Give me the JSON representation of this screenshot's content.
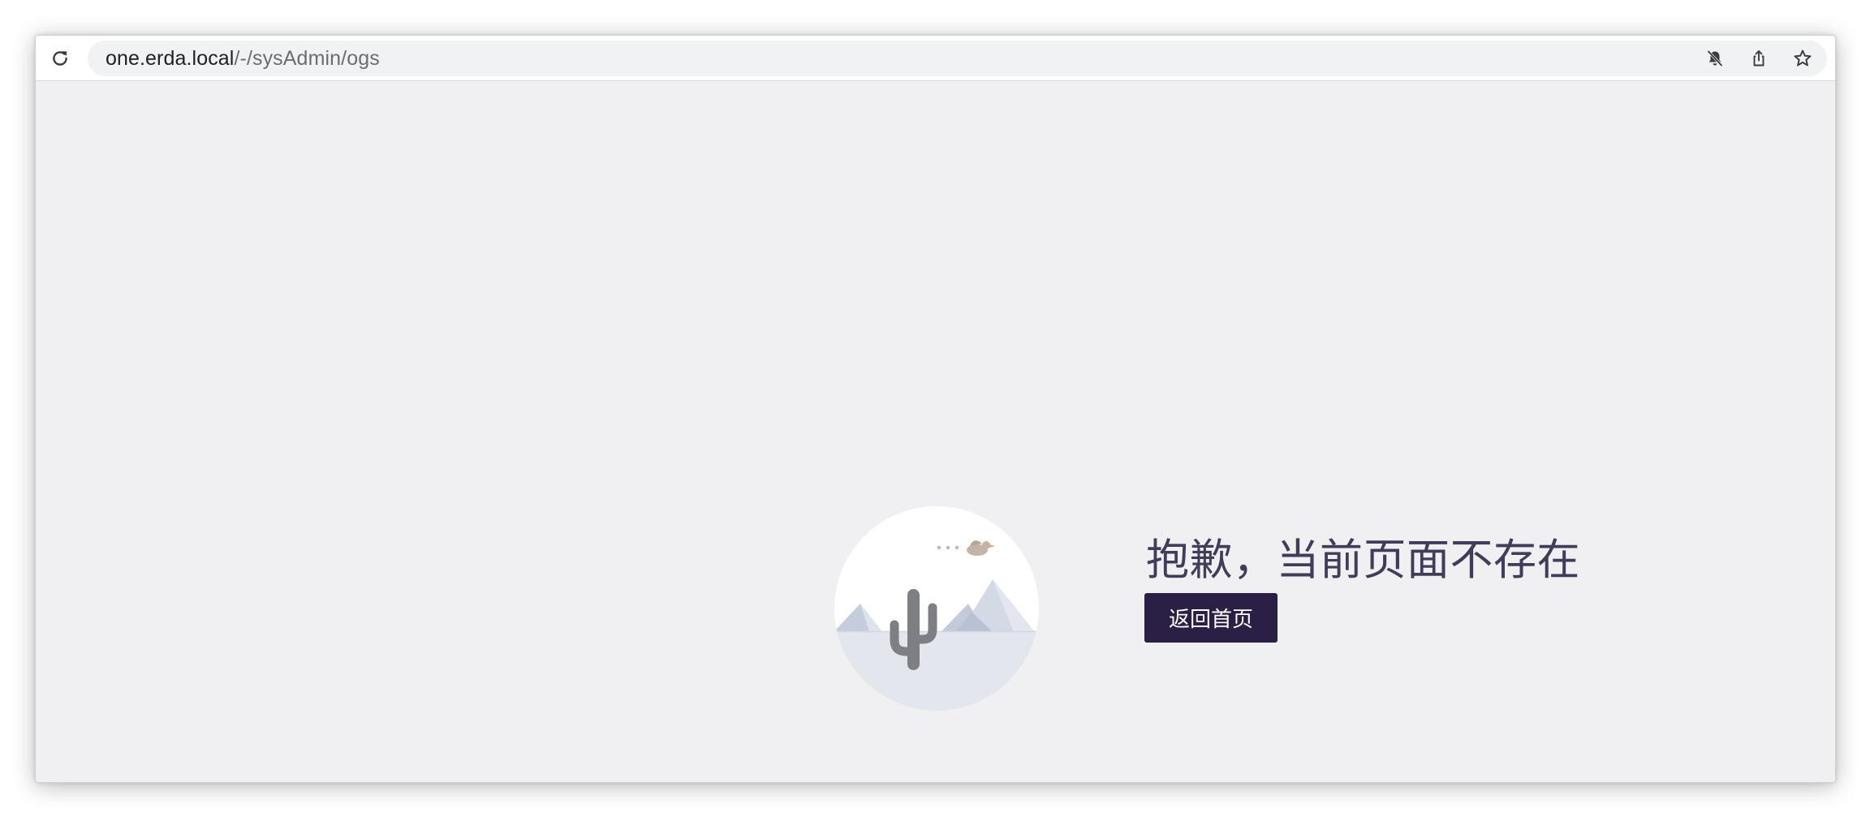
{
  "browser": {
    "url_host": "one.erda.local",
    "url_path": "/-/sysAdmin/ogs",
    "icons": {
      "reload": "reload-icon",
      "notifications_off": "bell-off-icon",
      "share": "share-icon",
      "bookmark": "star-icon"
    }
  },
  "not_found": {
    "message": "抱歉，当前页面不存在",
    "home_button_label": "返回首页",
    "illustration": "desert-cactus-illustration"
  },
  "colors": {
    "page_background": "#f0f0f2",
    "message_text": "#403c5a",
    "button_background": "#2b1f45",
    "button_text": "#ffffff"
  }
}
